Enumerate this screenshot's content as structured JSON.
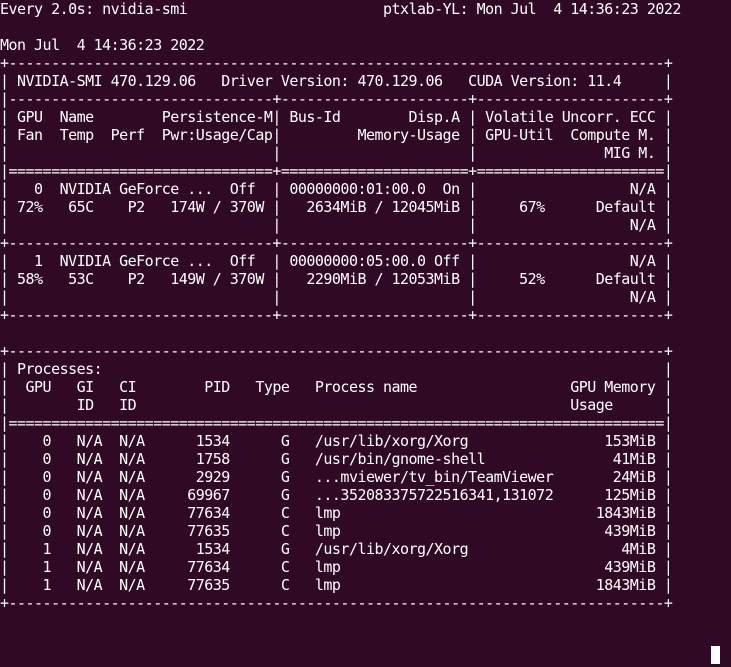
{
  "terminal": {
    "header_left": "Every 2.0s: nvidia-smi",
    "header_right": "ptxlab-YL: Mon Jul  4 14:36:23 2022",
    "timestamp": "Mon Jul  4 14:36:23 2022",
    "lines": [
      "+-----------------------------------------------------------------------------+",
      "| NVIDIA-SMI 470.129.06   Driver Version: 470.129.06   CUDA Version: 11.4     |",
      "|-------------------------------+----------------------+----------------------+",
      "| GPU  Name        Persistence-M| Bus-Id        Disp.A | Volatile Uncorr. ECC |",
      "| Fan  Temp  Perf  Pwr:Usage/Cap|         Memory-Usage | GPU-Util  Compute M. |",
      "|                               |                      |               MIG M. |",
      "|===============================+======================+======================|",
      "|   0  NVIDIA GeForce ...  Off  | 00000000:01:00.0  On |                  N/A |",
      "| 72%   65C    P2   174W / 370W |   2634MiB / 12045MiB |     67%      Default |",
      "|                               |                      |                  N/A |",
      "+-------------------------------+----------------------+----------------------+",
      "|   1  NVIDIA GeForce ...  Off  | 00000000:05:00.0 Off |                  N/A |",
      "| 58%   53C    P2   149W / 370W |   2290MiB / 12053MiB |     52%      Default |",
      "|                               |                      |                  N/A |",
      "+-------------------------------+----------------------+----------------------+",
      "",
      "+-----------------------------------------------------------------------------+",
      "| Processes:                                                                  |",
      "|  GPU   GI   CI        PID   Type   Process name                  GPU Memory |",
      "|        ID   ID                                                   Usage      |",
      "|=============================================================================|",
      "|    0   N/A  N/A      1534      G   /usr/lib/xorg/Xorg                153MiB |",
      "|    0   N/A  N/A      1758      G   /usr/bin/gnome-shell               41MiB |",
      "|    0   N/A  N/A      2929      G   ...mviewer/tv_bin/TeamViewer       24MiB |",
      "|    0   N/A  N/A     69967      G   ...352083375722516341,131072      125MiB |",
      "|    0   N/A  N/A     77634      C   lmp                              1843MiB |",
      "|    0   N/A  N/A     77635      C   lmp                               439MiB |",
      "|    1   N/A  N/A      1534      G   /usr/lib/xorg/Xorg                  4MiB |",
      "|    1   N/A  N/A     77634      C   lmp                               439MiB |",
      "|    1   N/A  N/A     77635      C   lmp                              1843MiB |",
      "+-----------------------------------------------------------------------------+"
    ]
  },
  "colors": {
    "background": "#300a24",
    "foreground": "#ffffff"
  }
}
